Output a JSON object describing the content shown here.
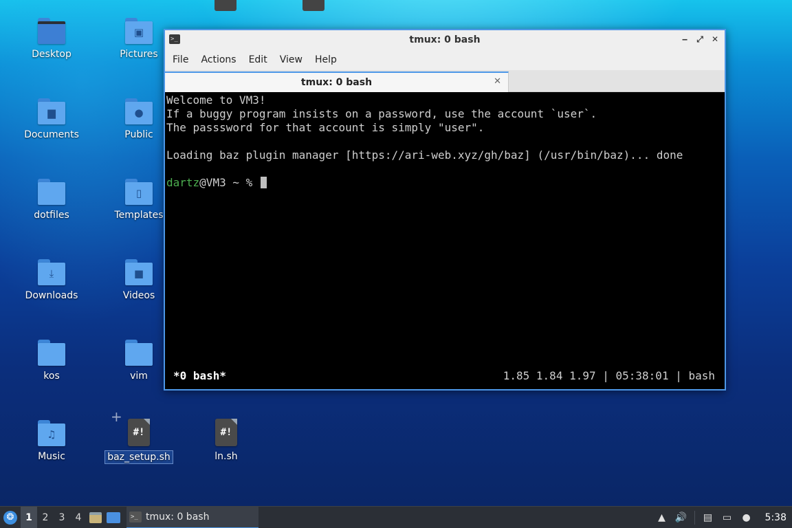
{
  "desktop": {
    "icons": [
      {
        "label": "Desktop",
        "glyph": ""
      },
      {
        "label": "Pictures",
        "glyph": "▣"
      },
      {
        "label": "Documents",
        "glyph": "▆"
      },
      {
        "label": "Public",
        "glyph": "●"
      },
      {
        "label": "dotfiles",
        "glyph": ""
      },
      {
        "label": "Templates",
        "glyph": "▯"
      },
      {
        "label": "Downloads",
        "glyph": "⤓"
      },
      {
        "label": "Videos",
        "glyph": "■"
      },
      {
        "label": "kos",
        "glyph": ""
      },
      {
        "label": "vim",
        "glyph": ""
      },
      {
        "label": "Music",
        "glyph": "♫"
      },
      {
        "label": "baz_setup.sh",
        "glyph": "#!"
      },
      {
        "label": "ln.sh",
        "glyph": "#!"
      }
    ]
  },
  "window": {
    "title": "tmux: 0 bash",
    "menu": [
      "File",
      "Actions",
      "Edit",
      "View",
      "Help"
    ],
    "tab_label": "tmux: 0 bash",
    "controls": {
      "minimize": "‒",
      "maximize": "⤢",
      "close": "✕"
    }
  },
  "terminal": {
    "lines": [
      "Welcome to VM3!",
      "If a buggy program insists on a password, use the account `user`.",
      "The passsword for that account is simply \"user\".",
      "",
      "Loading baz plugin manager [https://ari-web.xyz/gh/baz] (/usr/bin/baz)... done",
      ""
    ],
    "prompt_user": "dartz",
    "prompt_rest": "@VM3 ~ % "
  },
  "tmux_status": {
    "window_label": "*0 bash*",
    "right": "1.85 1.84 1.97 | 05:38:01 | bash"
  },
  "taskbar": {
    "workspaces": [
      "1",
      "2",
      "3",
      "4"
    ],
    "active_workspace": "1",
    "task_label": "tmux: 0 bash",
    "clock": "5:38",
    "tray_icons": [
      "notifications-icon",
      "volume-icon",
      "clipboard-icon",
      "network-icon",
      "updates-icon"
    ]
  }
}
